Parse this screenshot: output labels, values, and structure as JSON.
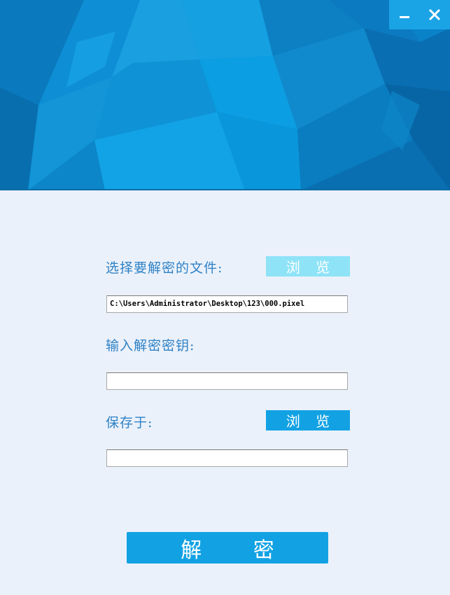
{
  "window": {
    "controls": {
      "minimize_icon": "minimize-icon",
      "close_icon": "close-icon"
    }
  },
  "form": {
    "source_file": {
      "label": "选择要解密的文件:",
      "browse_label": "浏 览",
      "path_value": "C:\\Users\\Administrator\\Desktop\\123\\000.pixel"
    },
    "key": {
      "label": "输入解密密钥:",
      "value": ""
    },
    "save_to": {
      "label": "保存于:",
      "browse_label": "浏 览",
      "path_value": ""
    },
    "decrypt_button_label": "解 密"
  },
  "colors": {
    "banner_base": "#0a82c8",
    "background": "#ebf1fa",
    "label_text": "#2f82c6",
    "browse_light": "#8fe3f7",
    "accent": "#12a2e4"
  }
}
